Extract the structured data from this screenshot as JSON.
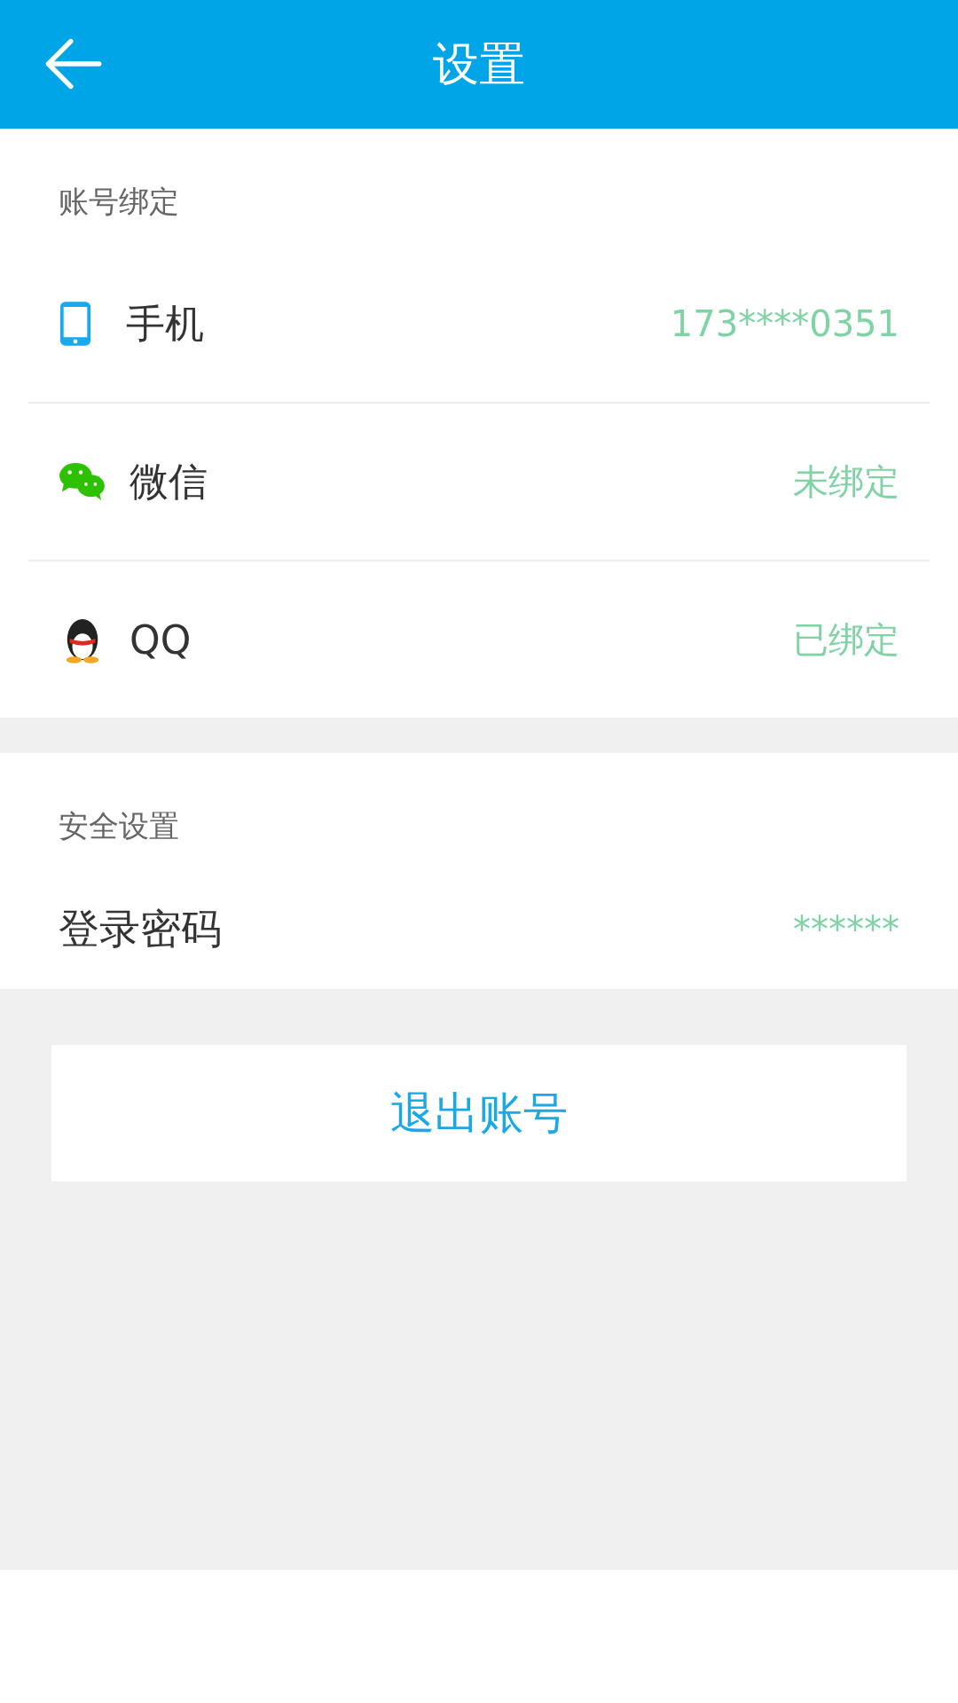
{
  "header": {
    "title": "设置"
  },
  "sections": [
    {
      "title": "账号绑定",
      "rows": [
        {
          "kind": "phone",
          "label": "手机",
          "value": "173****0351"
        },
        {
          "kind": "chat",
          "label": "微信",
          "value": "未绑定"
        },
        {
          "kind": "penguin",
          "label": "QQ",
          "value": "已绑定"
        }
      ]
    },
    {
      "title": "安全设置",
      "rows": [
        {
          "kind": "plain",
          "label": "登录密码",
          "value": "******"
        }
      ]
    }
  ],
  "logout_button": "退出账号"
}
